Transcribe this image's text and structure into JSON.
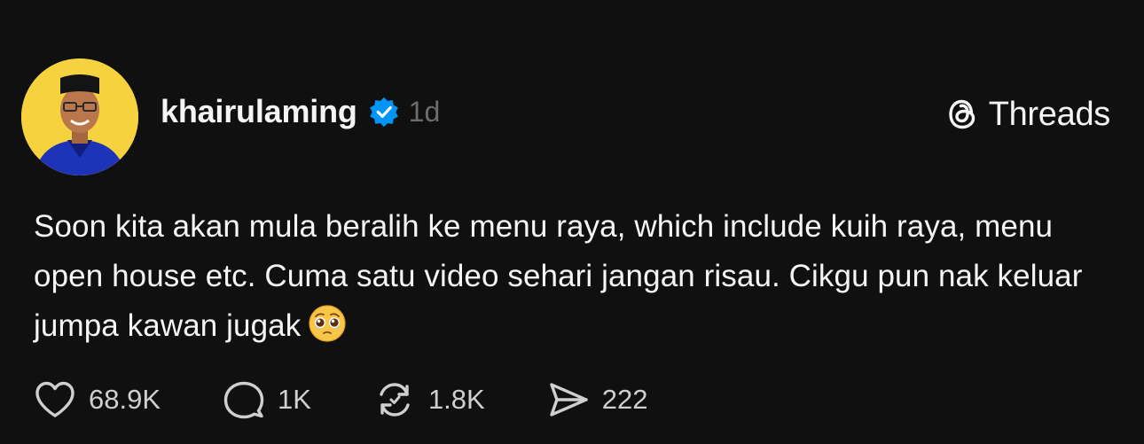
{
  "post": {
    "author": {
      "username": "khairulaming",
      "verified": true,
      "avatar_bg": "#f5d23e"
    },
    "timestamp": "1d",
    "brand": {
      "label": "Threads",
      "icon": "threads-logo-icon"
    },
    "text": {
      "body": "Soon kita akan mula beralih ke menu raya, which include kuih raya, menu open house etc. Cuma satu video sehari jangan risau. Cikgu pun nak keluar jumpa kawan jugak",
      "emoji": "🥹"
    },
    "actions": {
      "likes": "68.9K",
      "replies": "1K",
      "reposts": "1.8K",
      "shares": "222"
    }
  },
  "colors": {
    "background": "#101010",
    "text": "#f3f5f7",
    "muted": "#6c6c6c",
    "verified": "#0095f6"
  }
}
